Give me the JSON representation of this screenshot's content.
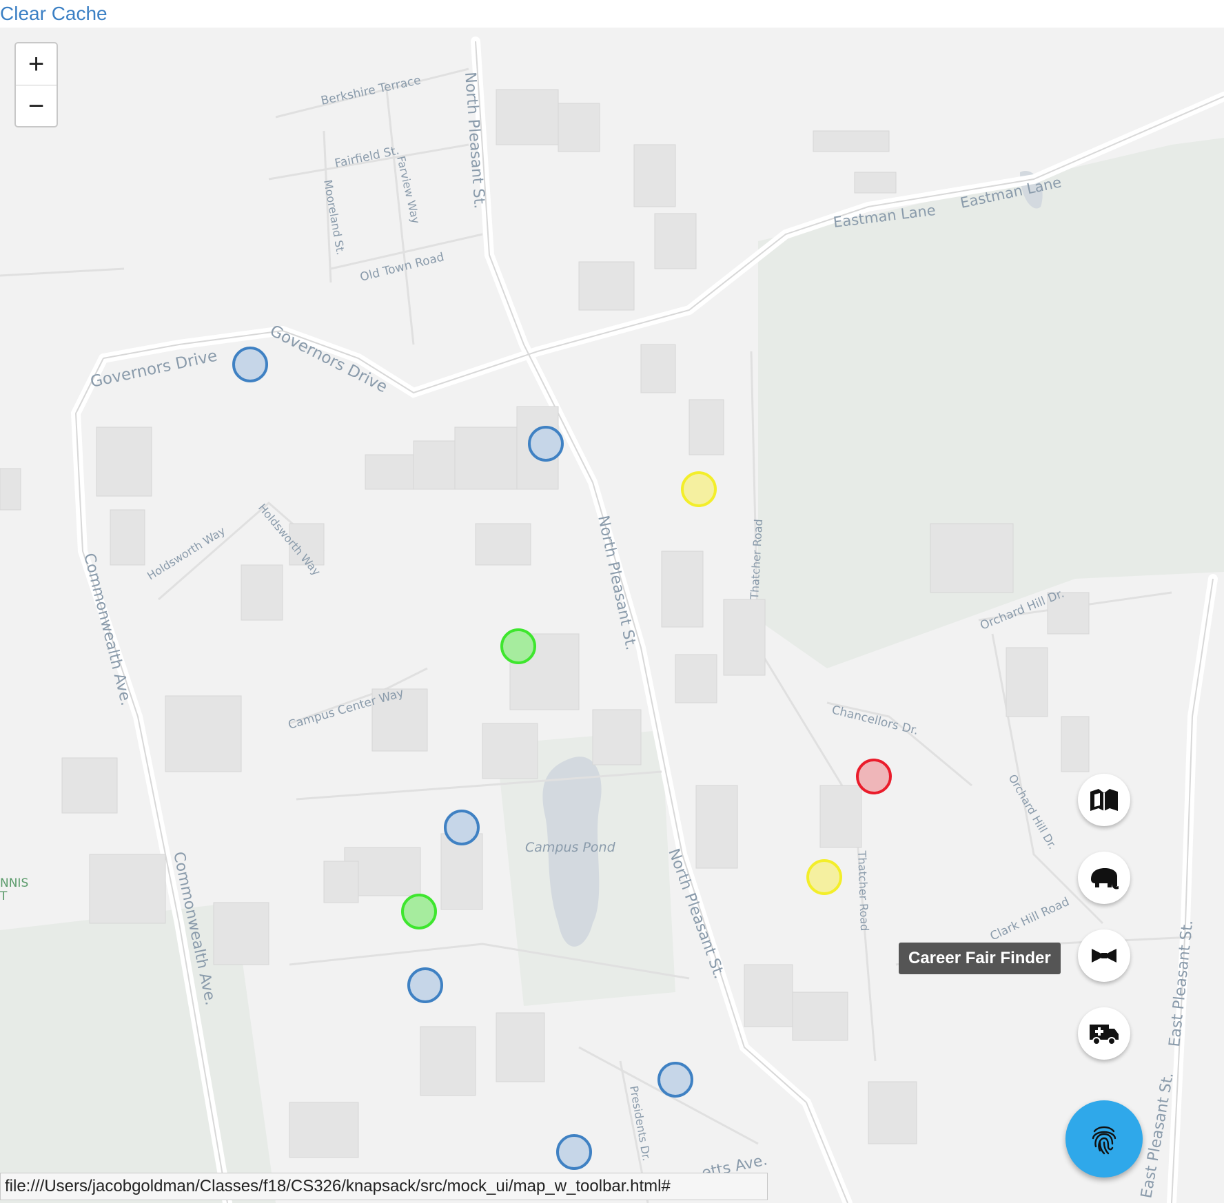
{
  "toolbar": {
    "clear_cache_label": "Clear Cache"
  },
  "zoom": {
    "in_label": "+",
    "out_label": "−"
  },
  "streets": {
    "berkshire": "Berkshire Terrace",
    "fairfield": "Fairfield St.",
    "mooreland": "Mooreland St.",
    "farview": "Farview Way",
    "old_town": "Old Town Road",
    "north_pleasant_1": "North Pleasant St.",
    "north_pleasant_2": "North Pleasant St.",
    "north_pleasant_3": "North Pleasant St.",
    "eastman_1": "Eastman Lane",
    "eastman_2": "Eastman Lane",
    "governors_1": "Governors Drive",
    "governors_2": "Governors Drive",
    "holdsworth_1": "Holdsworth Way",
    "holdsworth_2": "Holdsworth Way",
    "commonwealth_1": "Commonwealth Ave.",
    "commonwealth_2": "Commonwealth Ave.",
    "campus_center": "Campus Center Way",
    "thatcher_1": "Thatcher Road",
    "thatcher_2": "Thatcher Road",
    "orchard_hill_1": "Orchard Hill Dr.",
    "orchard_hill_2": "Orchard Hill Dr.",
    "chancellors": "Chancellors Dr.",
    "clark_hill": "Clark Hill Road",
    "east_pleasant_1": "East Pleasant St.",
    "east_pleasant_2": "East Pleasant St.",
    "presidents": "Presidents Dr.",
    "massachusetts": "etts Ave.",
    "campus_pond": "Campus Pond",
    "tennis": "NNIS",
    "tennis_2": "T"
  },
  "markers": [
    {
      "color": "blue"
    },
    {
      "color": "blue"
    },
    {
      "color": "yellow"
    },
    {
      "color": "green"
    },
    {
      "color": "red"
    },
    {
      "color": "blue"
    },
    {
      "color": "yellow"
    },
    {
      "color": "green"
    },
    {
      "color": "blue"
    },
    {
      "color": "blue"
    },
    {
      "color": "blue"
    }
  ],
  "marker_colors": {
    "blue": {
      "stroke": "#3f81c3",
      "fill": "#c6d6e8"
    },
    "yellow": {
      "stroke": "#f3ee2a",
      "fill": "#f5f0a0"
    },
    "green": {
      "stroke": "#3ee62e",
      "fill": "#a6ec9e"
    },
    "red": {
      "stroke": "#ea1c2b",
      "fill": "#efb6b9"
    }
  },
  "fab_menu": [
    {
      "name": "map-book-icon"
    },
    {
      "name": "elephant-icon"
    },
    {
      "name": "bowtie-icon",
      "tooltip": "Career Fair Finder"
    },
    {
      "name": "ambulance-icon"
    }
  ],
  "main_fab": {
    "icon": "fingerprint-icon",
    "color": "#2fa8ea"
  },
  "tooltip": {
    "text": "Career Fair Finder"
  },
  "status_bar": {
    "url": "file:///Users/jacobgoldman/Classes/f18/CS326/knapsack/src/mock_ui/map_w_toolbar.html#"
  }
}
